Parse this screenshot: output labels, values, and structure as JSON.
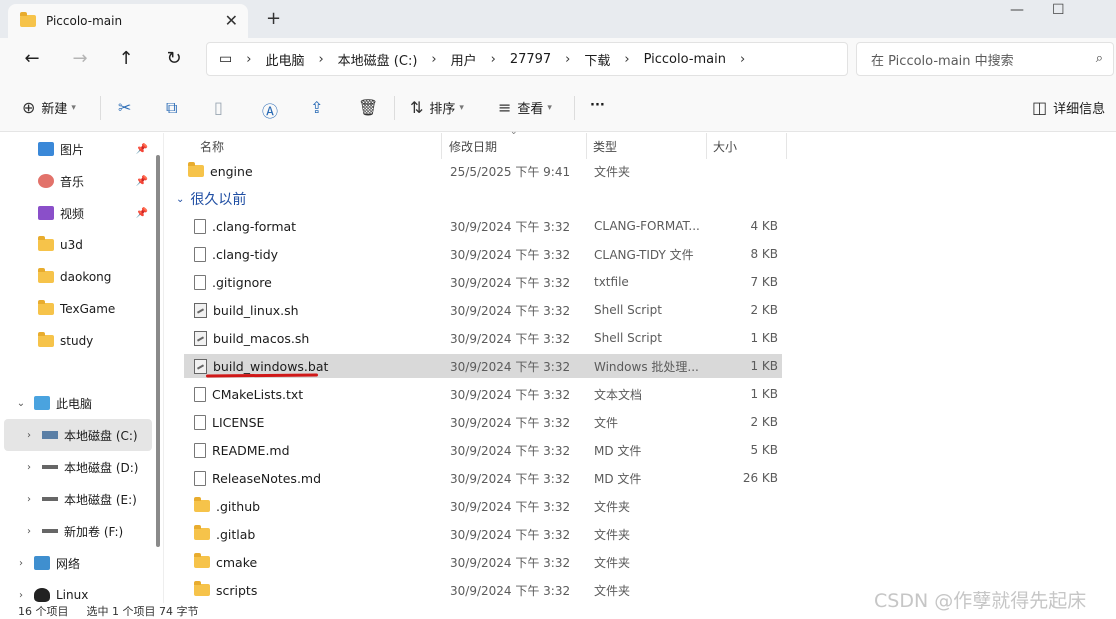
{
  "window": {
    "tab_title": "Piccolo-main",
    "close_tab": "✕",
    "new_tab": "+",
    "minimize": "—",
    "maximize": "☐"
  },
  "nav": {
    "back": "←",
    "forward": "→",
    "up": "↑",
    "refresh": "↻",
    "breadcrumbs": [
      "此电脑",
      "本地磁盘 (C:)",
      "用户",
      "27797",
      "下载",
      "Piccolo-main"
    ],
    "search_placeholder": "在 Piccolo-main 中搜索"
  },
  "toolbar": {
    "new_label": "新建",
    "sort_label": "排序",
    "view_label": "查看",
    "more_label": "···",
    "details_label": "详细信息"
  },
  "sidebar": {
    "quick": [
      {
        "label": "图片",
        "pinned": true
      },
      {
        "label": "音乐",
        "pinned": true
      },
      {
        "label": "视频",
        "pinned": true
      },
      {
        "label": "u3d",
        "pinned": false
      },
      {
        "label": "daokong",
        "pinned": false
      },
      {
        "label": "TexGame",
        "pinned": false
      },
      {
        "label": "study",
        "pinned": false
      }
    ],
    "this_pc": "此电脑",
    "drives": [
      "本地磁盘 (C:)",
      "本地磁盘 (D:)",
      "本地磁盘 (E:)",
      "新加卷 (F:)"
    ],
    "network": "网络",
    "linux": "Linux"
  },
  "columns": {
    "name": "名称",
    "date": "修改日期",
    "type": "类型",
    "size": "大小"
  },
  "group_header": "很久以前",
  "top_file": {
    "name": "engine",
    "date": "25/5/2025 下午 9:41",
    "type": "文件夹",
    "size": ""
  },
  "files": [
    {
      "name": ".clang-format",
      "date": "30/9/2024 下午 3:32",
      "type": "CLANG-FORMAT...",
      "size": "4 KB",
      "icon": "file"
    },
    {
      "name": ".clang-tidy",
      "date": "30/9/2024 下午 3:32",
      "type": "CLANG-TIDY 文件",
      "size": "8 KB",
      "icon": "file"
    },
    {
      "name": ".gitignore",
      "date": "30/9/2024 下午 3:32",
      "type": "txtfile",
      "size": "7 KB",
      "icon": "file"
    },
    {
      "name": "build_linux.sh",
      "date": "30/9/2024 下午 3:32",
      "type": "Shell Script",
      "size": "2 KB",
      "icon": "script"
    },
    {
      "name": "build_macos.sh",
      "date": "30/9/2024 下午 3:32",
      "type": "Shell Script",
      "size": "1 KB",
      "icon": "script"
    },
    {
      "name": "build_windows.bat",
      "date": "30/9/2024 下午 3:32",
      "type": "Windows 批处理...",
      "size": "1 KB",
      "icon": "script"
    },
    {
      "name": "CMakeLists.txt",
      "date": "30/9/2024 下午 3:32",
      "type": "文本文档",
      "size": "1 KB",
      "icon": "file"
    },
    {
      "name": "LICENSE",
      "date": "30/9/2024 下午 3:32",
      "type": "文件",
      "size": "2 KB",
      "icon": "file"
    },
    {
      "name": "README.md",
      "date": "30/9/2024 下午 3:32",
      "type": "MD 文件",
      "size": "5 KB",
      "icon": "file"
    },
    {
      "name": "ReleaseNotes.md",
      "date": "30/9/2024 下午 3:32",
      "type": "MD 文件",
      "size": "26 KB",
      "icon": "file"
    },
    {
      "name": ".github",
      "date": "30/9/2024 下午 3:32",
      "type": "文件夹",
      "size": "",
      "icon": "folder"
    },
    {
      "name": ".gitlab",
      "date": "30/9/2024 下午 3:32",
      "type": "文件夹",
      "size": "",
      "icon": "folder"
    },
    {
      "name": "cmake",
      "date": "30/9/2024 下午 3:32",
      "type": "文件夹",
      "size": "",
      "icon": "folder"
    },
    {
      "name": "scripts",
      "date": "30/9/2024 下午 3:32",
      "type": "文件夹",
      "size": "",
      "icon": "folder"
    }
  ],
  "status": {
    "count": "16 个项目",
    "selected": "选中 1 个项目  74 字节"
  },
  "watermark": "CSDN @作孽就得先起床",
  "colors": {
    "accent": "#2a6bb5",
    "selection": "#d9d9d9",
    "annotation_red": "#d01818"
  }
}
